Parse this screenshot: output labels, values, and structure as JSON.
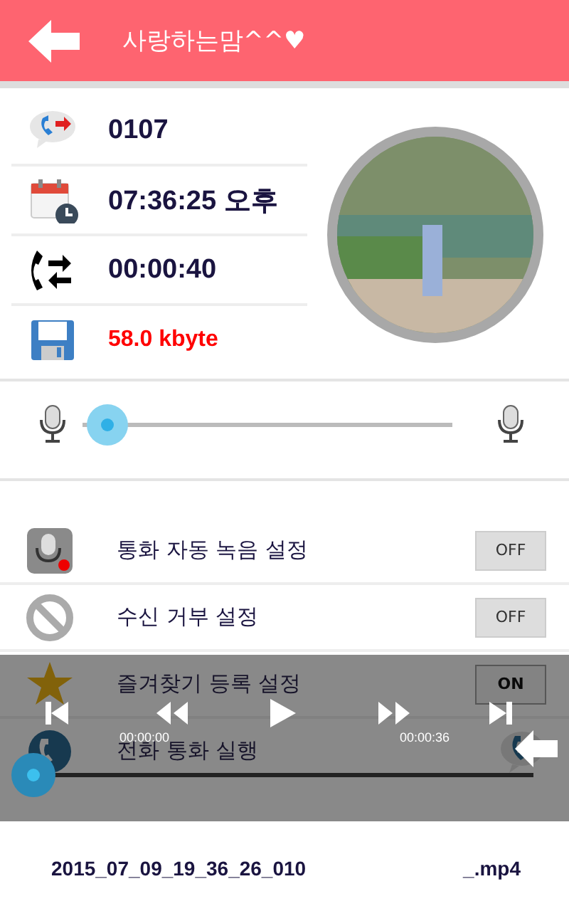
{
  "header": {
    "title": "사랑하는맘^^♥"
  },
  "details": [
    {
      "kind": "number",
      "text": "0107"
    },
    {
      "kind": "time",
      "text": "07:36:25 오후"
    },
    {
      "kind": "duration",
      "text": "00:00:40"
    },
    {
      "kind": "size",
      "text": "58.0 kbyte"
    }
  ],
  "volume": {
    "level": 0.02
  },
  "settings": [
    {
      "kind": "toggle",
      "label": "통화 자동 녹음 설정",
      "on": false,
      "state_text": "OFF"
    },
    {
      "kind": "toggle",
      "label": "수신 거부 설정",
      "on": false,
      "state_text": "OFF"
    },
    {
      "kind": "toggle",
      "label": "즐겨찾기 등록 설정",
      "on": true,
      "state_text": "ON"
    },
    {
      "kind": "action",
      "label": "전화 통화 실행"
    }
  ],
  "player": {
    "elapsed": "00:00:00",
    "total": "00:00:36",
    "level": 0
  },
  "file": {
    "name": "2015_07_09_19_36_26_010",
    "extension": "_.mp4"
  }
}
